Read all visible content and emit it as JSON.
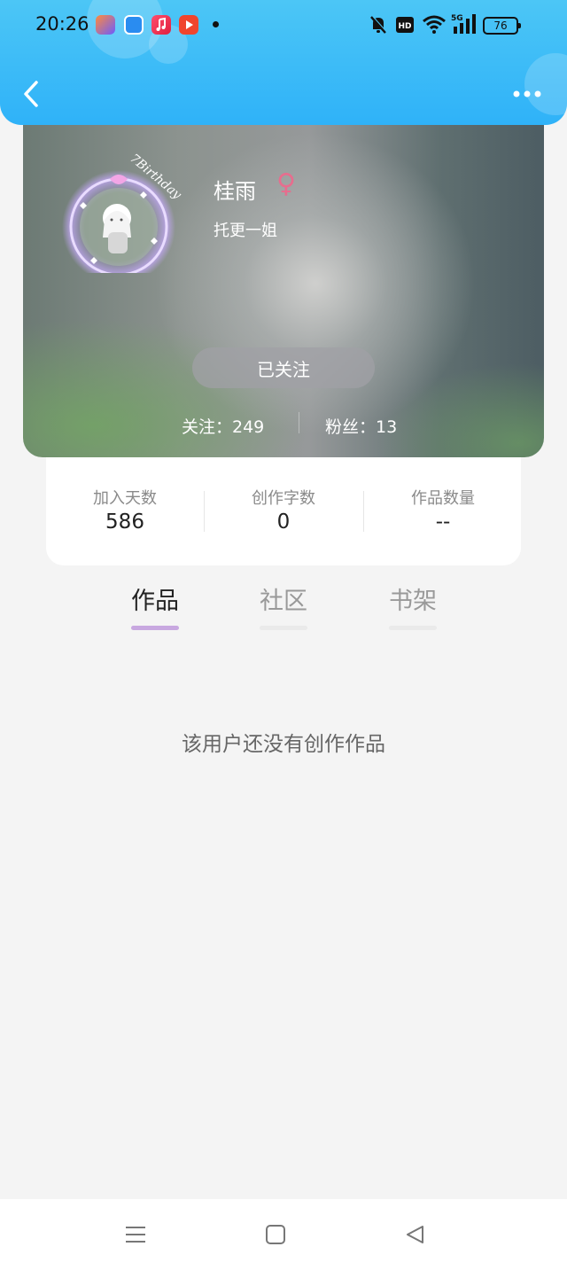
{
  "status_bar": {
    "time": "20:26",
    "battery": "76",
    "app_icons": [
      "shortcut-app-icon",
      "browser-app-icon",
      "music-app-icon",
      "video-app-icon"
    ],
    "system_icons": [
      "mute-icon",
      "hd-icon",
      "wifi-icon",
      "5g-signal-icon",
      "battery-icon"
    ]
  },
  "header": {
    "back_icon": "chevron-left-icon",
    "more_icon": "more-dots-icon"
  },
  "profile": {
    "avatar_text": "7Birthday",
    "username": "桂雨",
    "gender": "♀",
    "bio": "托更一姐",
    "follow_button": "已关注",
    "following": "关注：249",
    "followers": "粉丝：13"
  },
  "stats": [
    {
      "label": "加入天数",
      "value": "586"
    },
    {
      "label": "创作字数",
      "value": "0"
    },
    {
      "label": "作品数量",
      "value": "--"
    }
  ],
  "tabs": [
    {
      "label": "作品",
      "active": true
    },
    {
      "label": "社区",
      "active": false
    },
    {
      "label": "书架",
      "active": false
    }
  ],
  "empty_message": "该用户还没有创作作品",
  "nav_bar": [
    "menu-icon",
    "home-icon",
    "back-triangle-icon"
  ],
  "colors": {
    "header": "#2fb2f8",
    "tab_active_underline": "#c8a8e0",
    "tab_inactive_underline": "#eaeaea",
    "gender": "#e76d8e"
  }
}
